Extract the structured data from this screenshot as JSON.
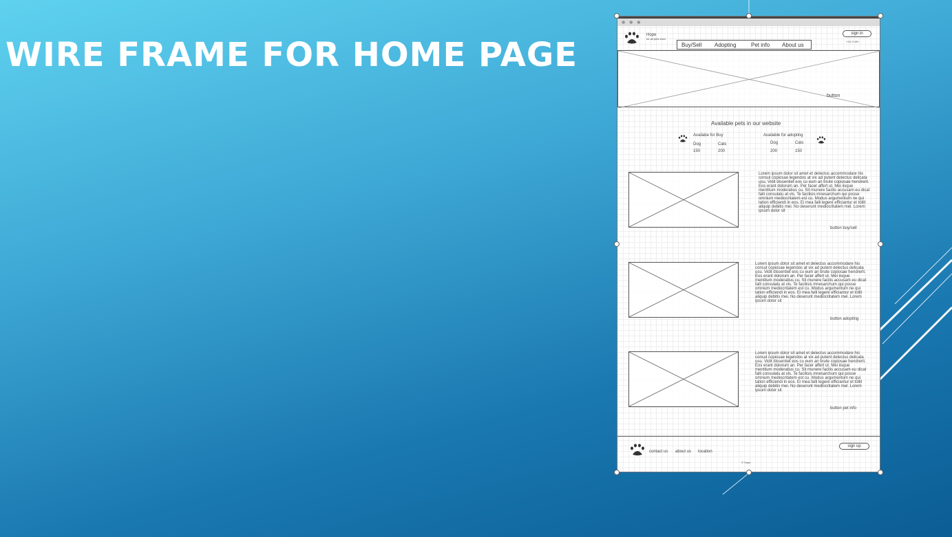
{
  "slide": {
    "title": "WIRE FRAME FOR HOME PAGE"
  },
  "wireframe": {
    "brand": {
      "name": "Hope",
      "tagline": "for all pets lover"
    },
    "nav": [
      "Buy/Sell",
      "Adopting",
      "Pet info",
      "About us"
    ],
    "sign_in": "sign in",
    "social": "f  IN  G  Wh",
    "hero_button": "button",
    "available": {
      "title": "Available pets in our website",
      "buy": {
        "heading": "Availabe for Buy",
        "dog_label": "Dog",
        "cats_label": "Cats",
        "dog_count": "150",
        "cats_count": "200"
      },
      "adopt": {
        "heading": "Available for adopting",
        "dog_label": "Dog",
        "cats_label": "Cats",
        "dog_count": "200",
        "cats_count": "150"
      }
    },
    "sections": [
      {
        "text": "Lorem ipsum dolor sit amet et delectus accommodare his consul copiosae legendos at vix ad putent delectus delicata usu. Vidit dissentiet eos cu eum an brute copiosae hendrerit. Eos erant dolorum an. Per facer affert ut. Mei iisque mentitum moderatius cu. Sit munere facilis accusam eu dicat falli consulatu at vis. Te facilisis mnesarchum qui posse omnium mediocritatem est cu. Modus argumentum ne qui tation efficiendi in eos. Ei mea falli legere efficiantur et tollit aliquip debitis mei. No deserunt mediocritatem mel. Lorem ipsum dolor sit",
        "button": "button buy/sell"
      },
      {
        "text": "Lorem ipsum dolor sit amet et delectus accommodare his consul copiosae legendos at vix ad putent delectus delicata usu. Vidit dissentiet eos cu eum an brute copiosae hendrerit. Eos erant dolorum an. Per facer affert ut. Mei iisque mentitum moderatius cu. Sit munere facilis accusam eu dicat falli consulatu at vis. Te facilisis mnesarchum qui posse omnium mediocritatem est cu. Modus argumentum ne qui tation efficiendi in eos. Ei mea falli legere efficiantur et tollit aliquip debitis mei. No deserunt mediocritatem mel. Lorem ipsum dolor sit",
        "button": "button adopting"
      },
      {
        "text": "Lorem ipsum dolor sit amet et delectus accommodare his consul copiosae legendos at vix ad putent delectus delicata usu. Vidit dissentiet eos cu eum an brute copiosae hendrerit. Eos erant dolorum an. Per facer affert ut. Mei iisque mentitum moderatius cu. Sit munere facilis accusam eu dicat falli consulatu at vis. Te facilisis mnesarchum qui posse omnium mediocritatem est cu. Modus argumentum ne qui tation efficiendi in eos. Ei mea falli legere efficiantur et tollit aliquip debitis mei. No deserunt mediocritatem mel. Lorem ipsum dolor sit",
        "button": "button pet info"
      }
    ],
    "footer": {
      "links": [
        "contact us",
        "about us",
        "location"
      ],
      "sign_up": "sign up",
      "copyright": "© Hope"
    }
  },
  "icons": {
    "paw": "paw-icon",
    "image_placeholder": "image-placeholder-icon"
  },
  "colors": {
    "slide_top": "#5fd2ef",
    "slide_bottom": "#0b5d95",
    "title": "#ffffff",
    "wire_stroke": "#555555"
  }
}
